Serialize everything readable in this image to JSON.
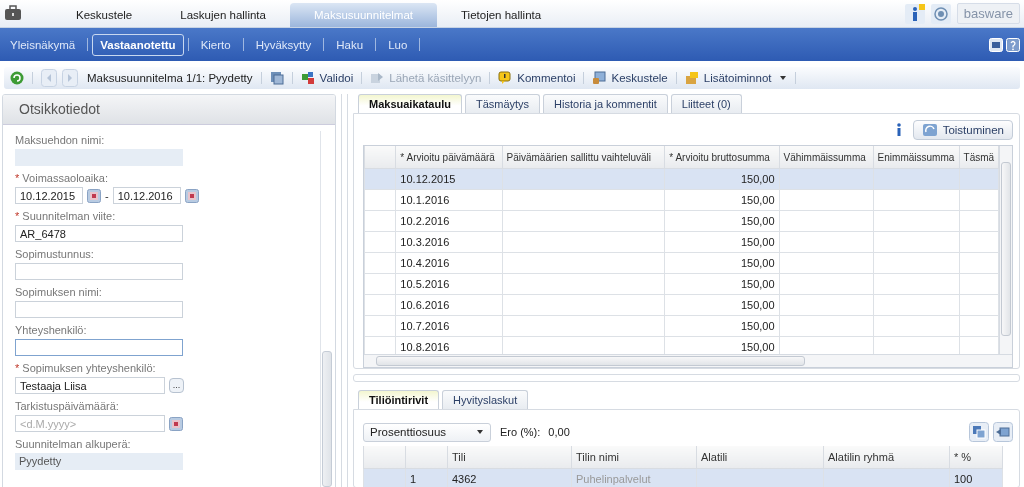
{
  "top_tabs": [
    {
      "label": "Keskustele",
      "selected": false
    },
    {
      "label": "Laskujen hallinta",
      "selected": false
    },
    {
      "label": "Maksusuunnitelmat",
      "selected": true
    },
    {
      "label": "Tietojen hallinta",
      "selected": false
    }
  ],
  "logo": "basware",
  "sub_nav": [
    {
      "label": "Yleisnäkymä",
      "selected": false
    },
    {
      "label": "Vastaanotettu",
      "selected": true
    },
    {
      "label": "Kierto",
      "selected": false
    },
    {
      "label": "Hyväksytty",
      "selected": false
    },
    {
      "label": "Haku",
      "selected": false
    },
    {
      "label": "Luo",
      "selected": false
    }
  ],
  "toolbar": {
    "record": "Maksusuunnitelma 1/1: Pyydetty",
    "actions": [
      {
        "label": "Validoi",
        "disabled": false,
        "has_menu": false,
        "kind": "validate"
      },
      {
        "label": "Lähetä käsittelyyn",
        "disabled": true,
        "has_menu": false,
        "kind": "send"
      },
      {
        "label": "Kommentoi",
        "disabled": false,
        "has_menu": false,
        "kind": "comment"
      },
      {
        "label": "Keskustele",
        "disabled": false,
        "has_menu": false,
        "kind": "discuss"
      },
      {
        "label": "Lisätoiminnot",
        "disabled": false,
        "has_menu": true,
        "kind": "more"
      }
    ]
  },
  "header_panel": {
    "title": "Otsikkotiedot",
    "fields": [
      {
        "kind": "readonly",
        "label": "Maksuehdon nimi:"
      },
      {
        "kind": "date_range",
        "label": "Voimassaoloaika:",
        "marker": "*",
        "value": "10.12.2015",
        "separator": "-",
        "value_2": "10.12.2016"
      },
      {
        "kind": "text",
        "label": "Suunnitelman viite:",
        "marker": "*",
        "value": "AR_6478",
        "focused": false
      },
      {
        "kind": "text",
        "label": "Sopimustunnus:",
        "focused": false
      },
      {
        "kind": "text",
        "label": "Sopimuksen nimi:",
        "focused": false
      },
      {
        "kind": "text",
        "label": "Yhteyshenkilö:",
        "focused": true
      },
      {
        "kind": "picker",
        "label": "Sopimuksen yhteyshenkilö:",
        "marker": "*",
        "value": "Testaaja Liisa",
        "button_label": "..."
      },
      {
        "kind": "date",
        "label": "Tarkistuspäivämäärä:",
        "placeholder": "<d.M.yyyy>"
      },
      {
        "kind": "readonly",
        "label": "Suunnitelman alkuperä:",
        "value": "Pyydetty"
      }
    ]
  },
  "schedule_tabs": [
    {
      "label": "Maksuaikataulu",
      "selected": true
    },
    {
      "label": "Täsmäytys",
      "selected": false
    },
    {
      "label": "Historia ja kommentit",
      "selected": false
    },
    {
      "label": "Liitteet (0)",
      "selected": false
    }
  ],
  "recurrence_button": "Toistuminen",
  "schedule_table": {
    "columns": [
      "* Arvioitu päivämäärä",
      "Päivämäärien sallittu vaihteluväli",
      "* Arvioitu bruttosumma",
      "Vähimmäissumma",
      "Enimmäissumma",
      "Täsmä"
    ],
    "rows": [
      {
        "selected": true,
        "cells": [
          "10.12.2015",
          null,
          "150,00",
          null,
          null,
          null
        ]
      },
      {
        "selected": false,
        "cells": [
          "10.1.2016",
          null,
          "150,00",
          null,
          null,
          null
        ]
      },
      {
        "selected": false,
        "cells": [
          "10.2.2016",
          null,
          "150,00",
          null,
          null,
          null
        ]
      },
      {
        "selected": false,
        "cells": [
          "10.3.2016",
          null,
          "150,00",
          null,
          null,
          null
        ]
      },
      {
        "selected": false,
        "cells": [
          "10.4.2016",
          null,
          "150,00",
          null,
          null,
          null
        ]
      },
      {
        "selected": false,
        "cells": [
          "10.5.2016",
          null,
          "150,00",
          null,
          null,
          null
        ]
      },
      {
        "selected": false,
        "cells": [
          "10.6.2016",
          null,
          "150,00",
          null,
          null,
          null
        ]
      },
      {
        "selected": false,
        "cells": [
          "10.7.2016",
          null,
          "150,00",
          null,
          null,
          null
        ]
      },
      {
        "selected": false,
        "cells": [
          "10.8.2016",
          null,
          "150,00",
          null,
          null,
          null
        ]
      }
    ]
  },
  "coding_tabs": [
    {
      "label": "Tiliöintirivit",
      "selected": true
    },
    {
      "label": "Hyvityslaskut",
      "selected": false
    }
  ],
  "coding": {
    "mode": "Prosenttiosuus",
    "difference_label": "Ero (%):",
    "difference": "0,00",
    "columns": [
      "Tili",
      "Tilin nimi",
      "Alatili",
      "Alatilin ryhmä",
      "* %"
    ],
    "rows": [
      {
        "selected": true,
        "number": "1",
        "cells": [
          "4362",
          "Puhelinpalvelut",
          null,
          null,
          "100"
        ]
      }
    ]
  }
}
